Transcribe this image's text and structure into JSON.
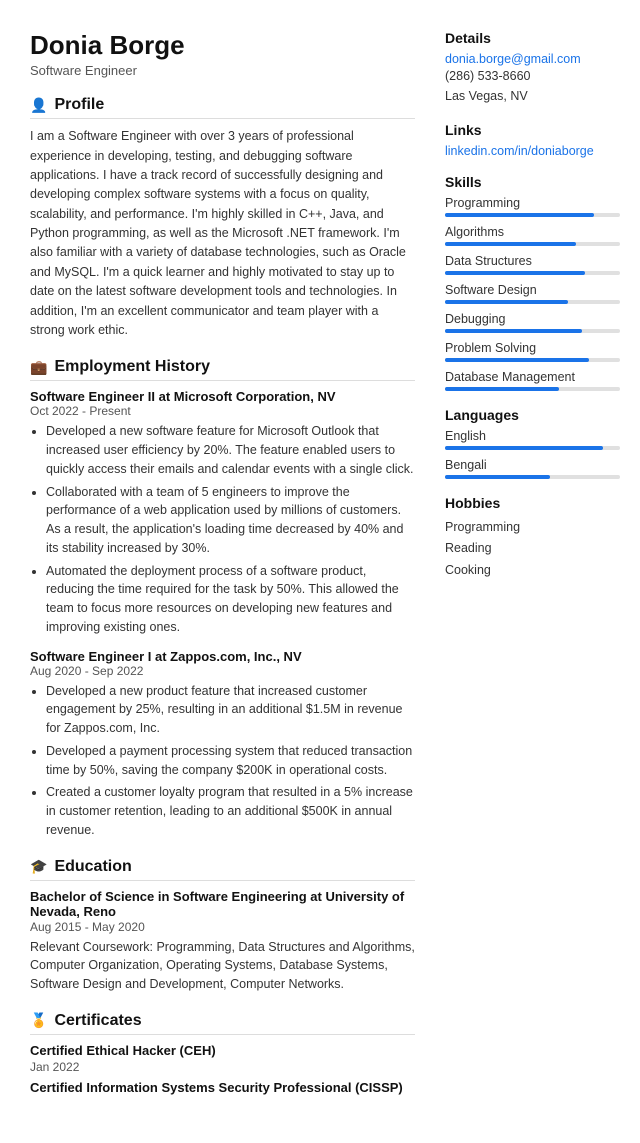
{
  "header": {
    "name": "Donia Borge",
    "title": "Software Engineer"
  },
  "sections": {
    "profile": {
      "heading": "Profile",
      "icon": "👤",
      "text": "I am a Software Engineer with over 3 years of professional experience in developing, testing, and debugging software applications. I have a track record of successfully designing and developing complex software systems with a focus on quality, scalability, and performance. I'm highly skilled in C++, Java, and Python programming, as well as the Microsoft .NET framework. I'm also familiar with a variety of database technologies, such as Oracle and MySQL. I'm a quick learner and highly motivated to stay up to date on the latest software development tools and technologies. In addition, I'm an excellent communicator and team player with a strong work ethic."
    },
    "employment": {
      "heading": "Employment History",
      "icon": "💼",
      "jobs": [
        {
          "title": "Software Engineer II at Microsoft Corporation, NV",
          "dates": "Oct 2022 - Present",
          "bullets": [
            "Developed a new software feature for Microsoft Outlook that increased user efficiency by 20%. The feature enabled users to quickly access their emails and calendar events with a single click.",
            "Collaborated with a team of 5 engineers to improve the performance of a web application used by millions of customers. As a result, the application's loading time decreased by 40% and its stability increased by 30%.",
            "Automated the deployment process of a software product, reducing the time required for the task by 50%. This allowed the team to focus more resources on developing new features and improving existing ones."
          ]
        },
        {
          "title": "Software Engineer I at Zappos.com, Inc., NV",
          "dates": "Aug 2020 - Sep 2022",
          "bullets": [
            "Developed a new product feature that increased customer engagement by 25%, resulting in an additional $1.5M in revenue for Zappos.com, Inc.",
            "Developed a payment processing system that reduced transaction time by 50%, saving the company $200K in operational costs.",
            "Created a customer loyalty program that resulted in a 5% increase in customer retention, leading to an additional $500K in annual revenue."
          ]
        }
      ]
    },
    "education": {
      "heading": "Education",
      "icon": "🎓",
      "entries": [
        {
          "title": "Bachelor of Science in Software Engineering at University of Nevada, Reno",
          "dates": "Aug 2015 - May 2020",
          "text": "Relevant Coursework: Programming, Data Structures and Algorithms, Computer Organization, Operating Systems, Database Systems, Software Design and Development, Computer Networks."
        }
      ]
    },
    "certificates": {
      "heading": "Certificates",
      "icon": "🏅",
      "items": [
        {
          "title": "Certified Ethical Hacker (CEH)",
          "date": "Jan 2022"
        },
        {
          "title": "Certified Information Systems Security Professional (CISSP)",
          "date": ""
        }
      ]
    }
  },
  "right": {
    "details": {
      "heading": "Details",
      "email": "donia.borge@gmail.com",
      "phone": "(286) 533-8660",
      "location": "Las Vegas, NV"
    },
    "links": {
      "heading": "Links",
      "items": [
        "linkedin.com/in/doniaborge"
      ]
    },
    "skills": {
      "heading": "Skills",
      "items": [
        {
          "label": "Programming",
          "pct": 85
        },
        {
          "label": "Algorithms",
          "pct": 75
        },
        {
          "label": "Data Structures",
          "pct": 80
        },
        {
          "label": "Software Design",
          "pct": 70
        },
        {
          "label": "Debugging",
          "pct": 78
        },
        {
          "label": "Problem Solving",
          "pct": 82
        },
        {
          "label": "Database Management",
          "pct": 65
        }
      ]
    },
    "languages": {
      "heading": "Languages",
      "items": [
        {
          "label": "English",
          "pct": 90
        },
        {
          "label": "Bengali",
          "pct": 60
        }
      ]
    },
    "hobbies": {
      "heading": "Hobbies",
      "items": [
        "Programming",
        "Reading",
        "Cooking"
      ]
    }
  }
}
